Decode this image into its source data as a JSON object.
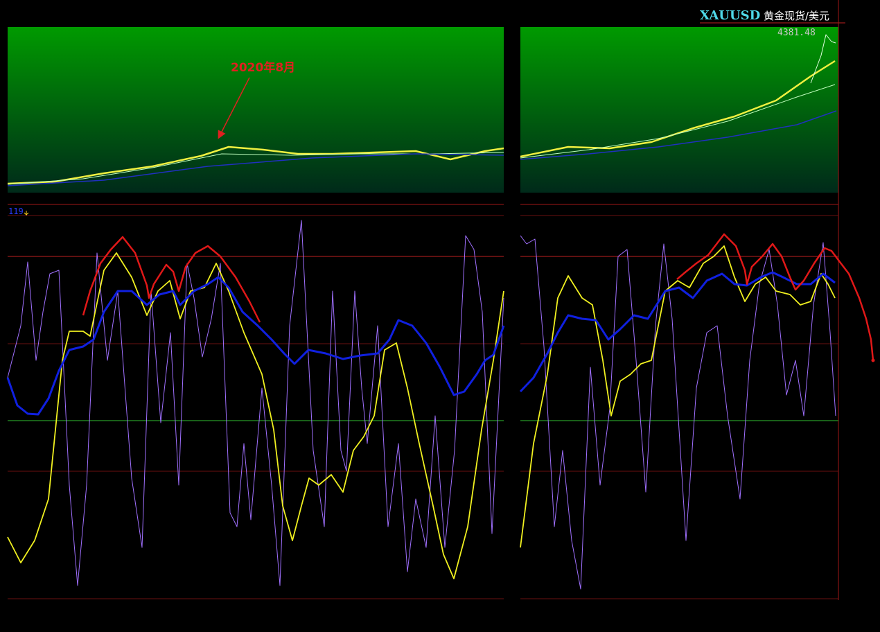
{
  "header": {
    "symbol": "XAUUSD",
    "name": "黄金现货/美元"
  },
  "chart_data": {
    "type": "line",
    "price_panel": {
      "last_price_label": "4381.48",
      "annotation": "2020年8月",
      "background": [
        "#00a000",
        "#002a18"
      ]
    },
    "oscillator_panel": {
      "top_label": "119",
      "series_colors": {
        "fast": "#a070ff",
        "slow": "#ffff20",
        "signal": "#1020e0",
        "peak": "#e01818"
      }
    }
  }
}
